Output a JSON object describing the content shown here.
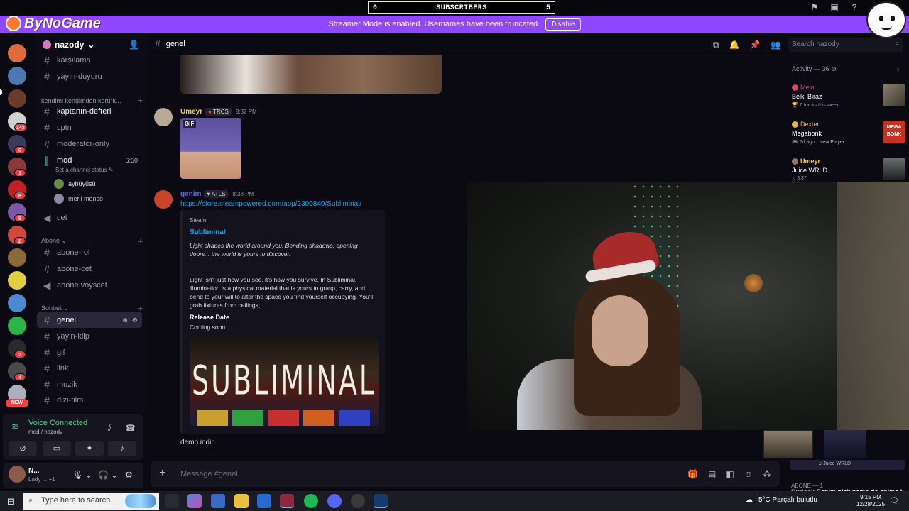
{
  "overlay": {
    "subscribers_label": "SUBSCRIBERS",
    "subscribers_left": "0",
    "subscribers_right": "5",
    "streamer_mode_text": "Streamer Mode is enabled. Usernames have been truncated.",
    "disable_label": "Disable",
    "logo_text": "ByNoGame"
  },
  "server_list": {
    "badges": [
      "143",
      "6",
      "1",
      "8",
      "8",
      "2",
      "2",
      "4"
    ],
    "new_label": "NEW"
  },
  "server": {
    "name": "nazody",
    "channels_top": [
      "karşılama",
      "yayın-duyuru"
    ],
    "category1": "kendimi kendimden korurk...",
    "channels_cat1": [
      "kaptanın-defteri",
      "cptn",
      "moderator-only"
    ],
    "voice_channel": {
      "name": "mod",
      "timer": "6:50",
      "status": "Set a channel status",
      "users": [
        "aybüyüsü",
        "merli monso"
      ]
    },
    "channel_cet": "cet",
    "category2": "Abone",
    "channels_cat2": [
      "abone-rol",
      "abone-cet",
      "abone voyscet"
    ],
    "category3": "Sohbet",
    "channels_cat3": [
      "genel",
      "yayin-klip",
      "gif",
      "link",
      "muzik",
      "dizi-film"
    ]
  },
  "voice_panel": {
    "status": "Voice Connected",
    "location": "mod / nazody"
  },
  "user_panel": {
    "name": "N...",
    "status": "Lady ...",
    "extra": "+1"
  },
  "chat": {
    "channel": "genel",
    "search_placeholder": "Search nazody",
    "messages": [
      {
        "author": "Umeyr",
        "tag": "TRCS",
        "time": "8:32 PM",
        "gif_label": "GIF"
      },
      {
        "author": "genim",
        "tag": "ATLS",
        "time": "8:38 PM",
        "link": "https://store.steampowered.com/app/2300840/Subliminal/"
      }
    ],
    "embed": {
      "provider": "Steam",
      "title": "Subliminal",
      "description": "Light shapes the world around you. Bending shadows, opening doors... the world is yours to discover.",
      "body": "Light isn't just how you see, it's how you survive. In Subliminal, illumination is a physical material that is yours to grasp, carry, and bend to your will to alter the space you find yourself occupying. You'll grab fixtures from ceilings,...",
      "field_name": "Release Date",
      "field_value": "Coming soon",
      "image_text": "SUBLIMINAL"
    },
    "last_message": "demo indir",
    "composer_placeholder": "Message #genel"
  },
  "activity": {
    "header": "Activity — 36",
    "items": [
      {
        "user": "Melo",
        "title": "Belki Biraz",
        "meta": "7 tracks this week",
        "user_color": "#e0426a"
      },
      {
        "user": "Dexter",
        "title": "Megabonk",
        "meta": "2d ago",
        "meta2": "New Player",
        "user_color": "#f0b232",
        "thumb_text": "MEGA BONK"
      },
      {
        "user": "Umeyr",
        "title": "Juice WRLD",
        "meta": "3:37",
        "user_color": "#f0d232"
      }
    ]
  },
  "stream_overlay": {
    "strip_text": "Juice WRLD",
    "abone_label": "ABONE — 1",
    "chat_user": "Rudosk",
    "chat_text": "Benim nick name de anime k yaptım sinsa bak"
  },
  "taskbar": {
    "search_placeholder": "Type here to search",
    "weather": "5°C  Parçalı bulutlu",
    "time": "9:15 PM",
    "date": "12/28/2025"
  }
}
